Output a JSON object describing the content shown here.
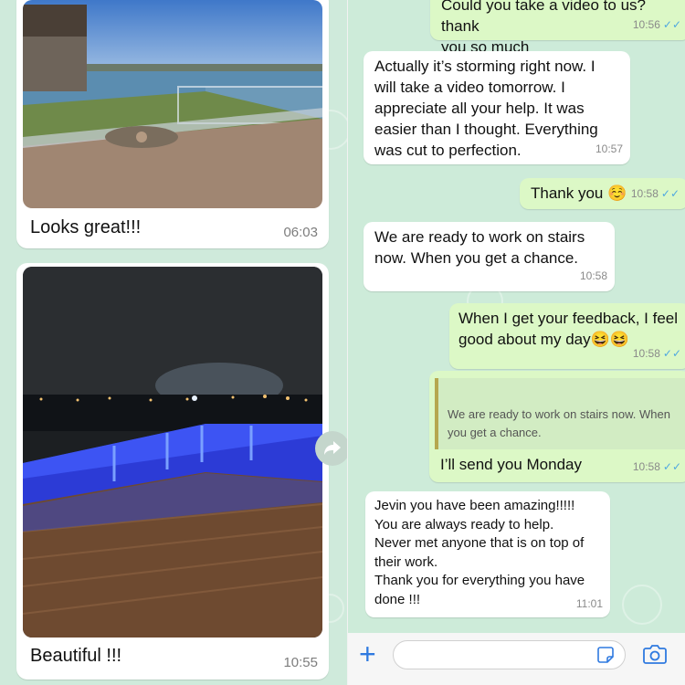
{
  "left": {
    "messages": [
      {
        "caption": "Looks great!!!",
        "time": "06:03",
        "photo": "lake-deck-daytime"
      },
      {
        "caption": "Beautiful !!!",
        "time": "10:55",
        "photo": "deck-night-blue-lights"
      }
    ]
  },
  "right": {
    "messages": [
      {
        "text": "Could you take a video to us? thank\nyou so much",
        "time": "10:56",
        "direction": "out"
      },
      {
        "text": "Actually it’s storming right now. I\nwill take a video tomorrow. I\nappreciate all your help. It was\neasier than I thought. Everything\nwas cut to perfection.",
        "time": "10:57",
        "direction": "in"
      },
      {
        "text": "Thank you ☺️",
        "time": "10:58",
        "direction": "out"
      },
      {
        "text": "We are ready to work on stairs\nnow. When you get a chance.",
        "time": "10:58",
        "direction": "in"
      },
      {
        "text": "When I get your feedback, I feel\ngood about my day😆😆",
        "time": "10:58",
        "direction": "out"
      },
      {
        "quoted": "We are ready to work on stairs now. When\nyou get a chance.",
        "text": "I’ll send you Monday",
        "time": "10:58",
        "direction": "out"
      },
      {
        "text": "Jevin you have been amazing!!!!!\nYou are always ready to help.\nNever met anyone that is on top of\ntheir work.\nThank you for everything you have\ndone !!!",
        "time": "11:01",
        "direction": "in"
      }
    ]
  },
  "input": {
    "placeholder": ""
  },
  "icons": {
    "forward": "forward-arrow-icon",
    "plus": "plus-icon",
    "sticker": "sticker-icon",
    "camera": "camera-icon",
    "read_tick": "double-check-icon"
  },
  "colors": {
    "incoming": "#ffffff",
    "outgoing": "#dcf8c6",
    "wallpaper": "#cfeadb",
    "accent": "#2f7ae0",
    "read_tick": "#4fa8e0"
  }
}
